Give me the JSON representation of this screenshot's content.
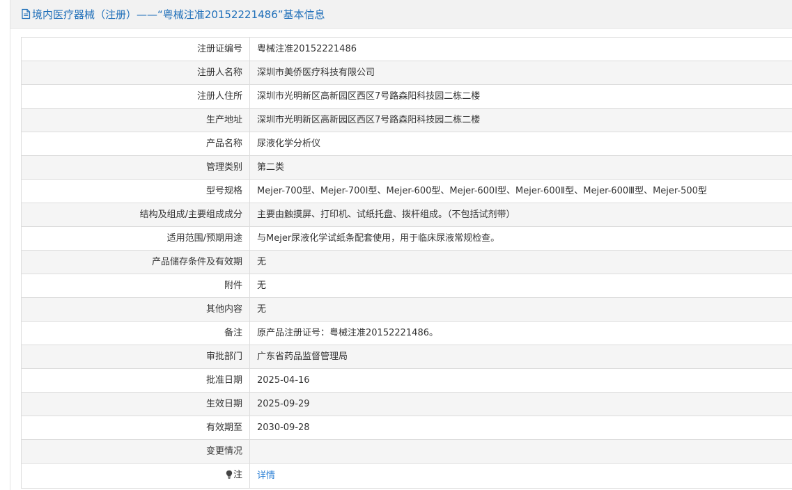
{
  "header": {
    "title": "境内医疗器械（注册）——“粤械注准20152221486”基本信息",
    "icon": "document-icon"
  },
  "rows": [
    {
      "label": "注册证编号",
      "value": "粤械注准20152221486"
    },
    {
      "label": "注册人名称",
      "value": "深圳市美侨医疗科技有限公司"
    },
    {
      "label": "注册人住所",
      "value": "深圳市光明新区高新园区西区7号路森阳科技园二栋二楼"
    },
    {
      "label": "生产地址",
      "value": "深圳市光明新区高新园区西区7号路森阳科技园二栋二楼"
    },
    {
      "label": "产品名称",
      "value": "尿液化学分析仪"
    },
    {
      "label": "管理类别",
      "value": "第二类"
    },
    {
      "label": "型号规格",
      "value": "Mejer-700型、Mejer-700I型、Mejer-600型、Mejer-600I型、Mejer-600Ⅱ型、Mejer-600Ⅲ型、Mejer-500型"
    },
    {
      "label": "结构及组成/主要组成成分",
      "value": "主要由触摸屏、打印机、试纸托盘、拨杆组成。（不包括试剂带）"
    },
    {
      "label": "适用范围/预期用途",
      "value": "与Mejer尿液化学试纸条配套使用，用于临床尿液常规检查。"
    },
    {
      "label": "产品储存条件及有效期",
      "value": "无"
    },
    {
      "label": "附件",
      "value": "无"
    },
    {
      "label": "其他内容",
      "value": "无"
    },
    {
      "label": "备注",
      "value": "原产品注册证号：粤械注准20152221486。"
    },
    {
      "label": "审批部门",
      "value": "广东省药品监督管理局"
    },
    {
      "label": "批准日期",
      "value": "2025-04-16"
    },
    {
      "label": "生效日期",
      "value": "2025-09-29"
    },
    {
      "label": "有效期至",
      "value": "2030-09-28"
    },
    {
      "label": "变更情况",
      "value": ""
    }
  ],
  "note_row": {
    "label": "注",
    "icon": "lightbulb-icon",
    "link_text": "详情"
  },
  "colors": {
    "title": "#1f6fb9",
    "link": "#2b7fd4",
    "header_bg": "#f2f2f2",
    "stripe_bg": "#f5f5f5",
    "border": "#dcdcdc"
  }
}
